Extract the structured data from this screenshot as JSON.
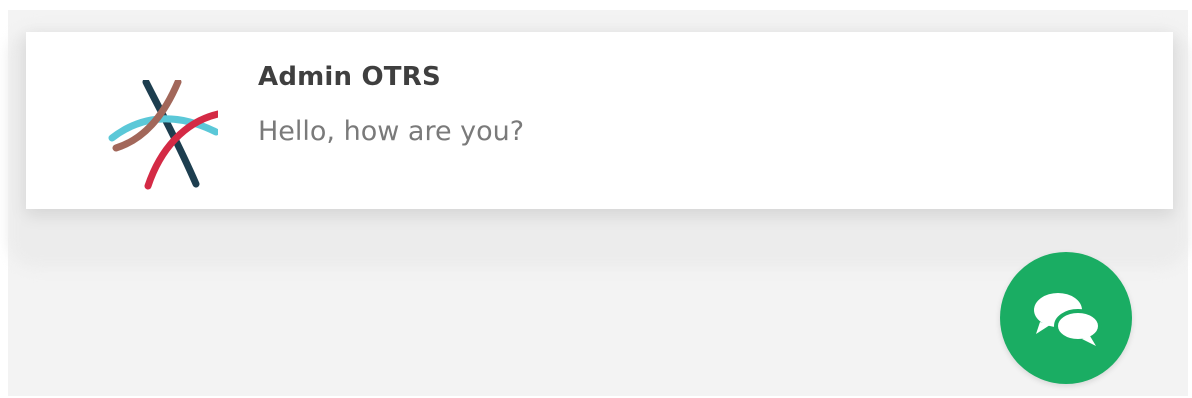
{
  "notification": {
    "sender": "Admin OTRS",
    "message": "Hello, how are you?",
    "avatar_icon": "otrs-logo-icon"
  },
  "chat_button": {
    "icon": "chat-bubbles-icon",
    "color": "#1aad63"
  },
  "colors": {
    "background": "#f3f3f3",
    "card": "#ffffff",
    "logo_teal": "#5bc8d8",
    "logo_brown": "#a2675a",
    "logo_navy": "#1d3e4f",
    "logo_red": "#d42a45"
  }
}
